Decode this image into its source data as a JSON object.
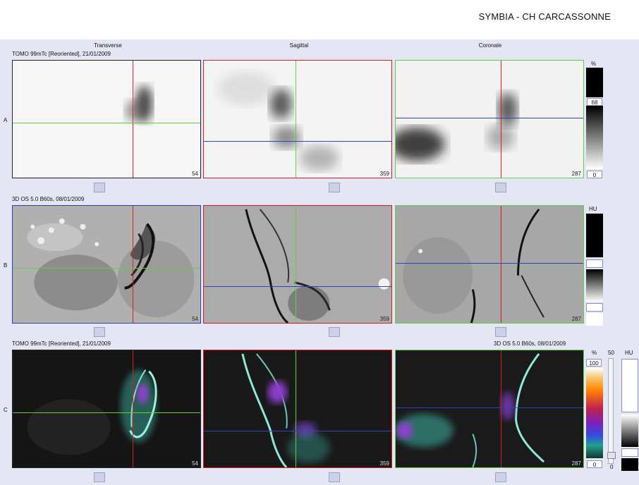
{
  "header": {
    "site_name": "SYMBIA - CH CARCASSONNE"
  },
  "columns": {
    "transverse": "Transverse",
    "sagittal": "Sagittal",
    "coronal": "Coronale"
  },
  "rows": {
    "a": {
      "label": "A",
      "series": "TOMO 99mTc [Reoriented], 21/01/2009"
    },
    "b": {
      "label": "B",
      "series": "3D  OS  5.0  B60s, 08/01/2009"
    },
    "c": {
      "label": "C",
      "series_left": "TOMO 99mTc [Reoriented], 21/01/2009",
      "series_right": "3D  OS  5.0  B60s, 08/01/2009"
    }
  },
  "slices": {
    "transverse": "54",
    "sagittal": "359",
    "coronal": "287"
  },
  "colorbars": {
    "a": {
      "unit": "%",
      "upper": "68",
      "lower": "0"
    },
    "b": {
      "unit": "HU"
    },
    "c": {
      "unit_left": "%",
      "top_left": "100",
      "bottom_left": "0",
      "mid_value": "50",
      "unit_right": "HU",
      "bottom_right": "0"
    }
  },
  "colors": {
    "crosshair_red": "#d02020",
    "crosshair_green": "#60d040",
    "crosshair_blue": "#3040c0",
    "background": "#e4e6f3",
    "fusion_bone": "#7fe0d0",
    "fusion_uptake": "#9040d0"
  }
}
